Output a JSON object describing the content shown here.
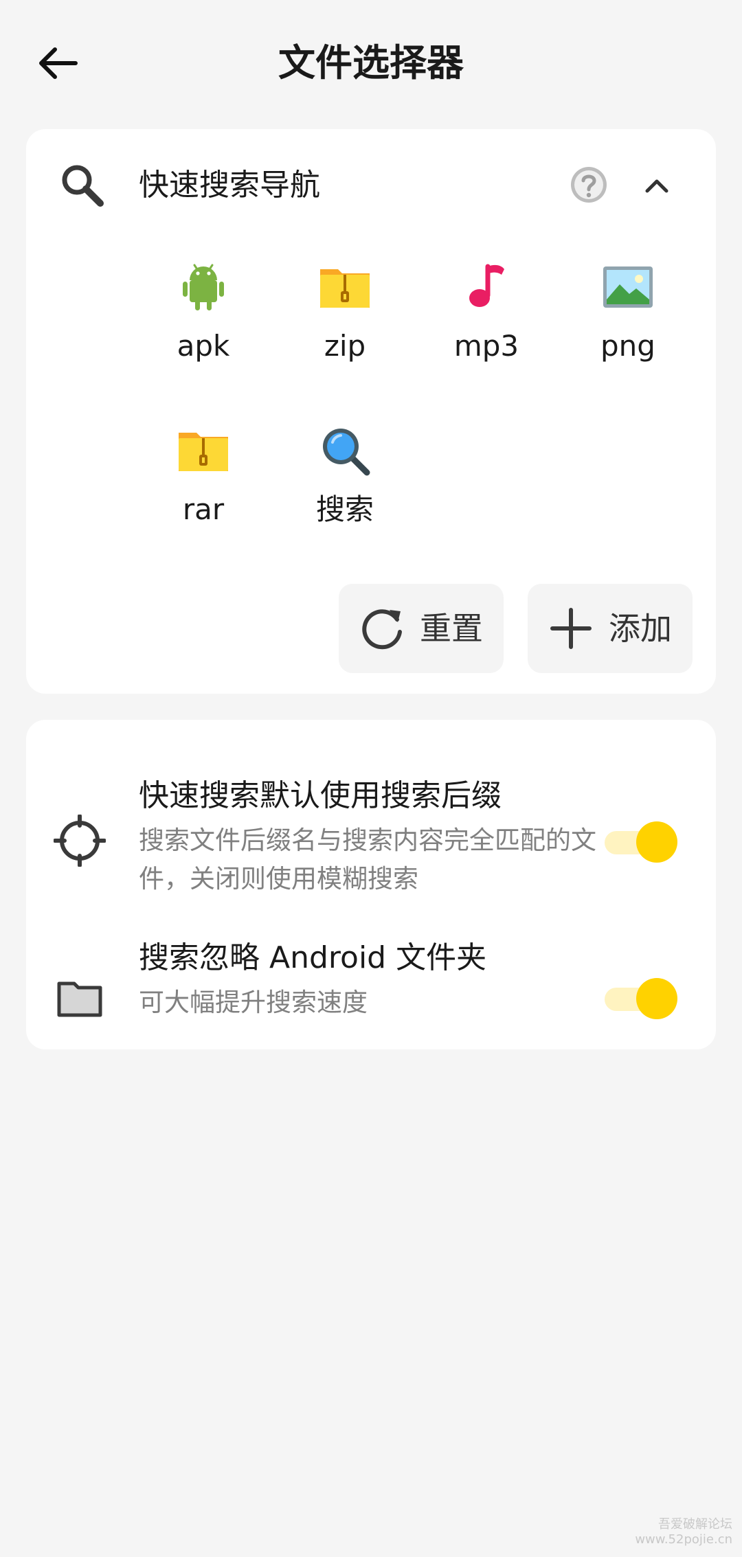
{
  "header": {
    "title": "文件选择器",
    "back_icon": "arrow-left-icon"
  },
  "quick_nav": {
    "title": "快速搜索导航",
    "icons": {
      "search": "search-icon",
      "help": "help-circle-icon",
      "collapse": "chevron-up-icon"
    },
    "types": [
      {
        "label": "apk",
        "icon": "android-icon",
        "color": "#7cb342"
      },
      {
        "label": "zip",
        "icon": "zip-folder-icon",
        "color": "#fbc02d"
      },
      {
        "label": "mp3",
        "icon": "music-note-icon",
        "color": "#e91e63"
      },
      {
        "label": "png",
        "icon": "image-icon",
        "color": "#4fa3e0"
      },
      {
        "label": "rar",
        "icon": "zip-folder-icon",
        "color": "#fbc02d"
      },
      {
        "label": "搜索",
        "icon": "magnifier-icon",
        "color": "#2196f3"
      }
    ],
    "actions": {
      "reset_label": "重置",
      "add_label": "添加"
    }
  },
  "settings": [
    {
      "title": "快速搜索默认使用搜索后缀",
      "description": "搜索文件后缀名与搜索内容完全匹配的文件，关闭则使用模糊搜索",
      "icon": "crosshair-icon",
      "enabled": true
    },
    {
      "title": "搜索忽略 Android 文件夹",
      "description": "可大幅提升搜索速度",
      "icon": "folder-icon",
      "enabled": true
    }
  ],
  "colors": {
    "accent": "#ffd200",
    "background": "#f5f5f5",
    "card": "#ffffff"
  },
  "watermark": {
    "line1": "吾爱破解论坛",
    "line2": "www.52pojie.cn"
  }
}
